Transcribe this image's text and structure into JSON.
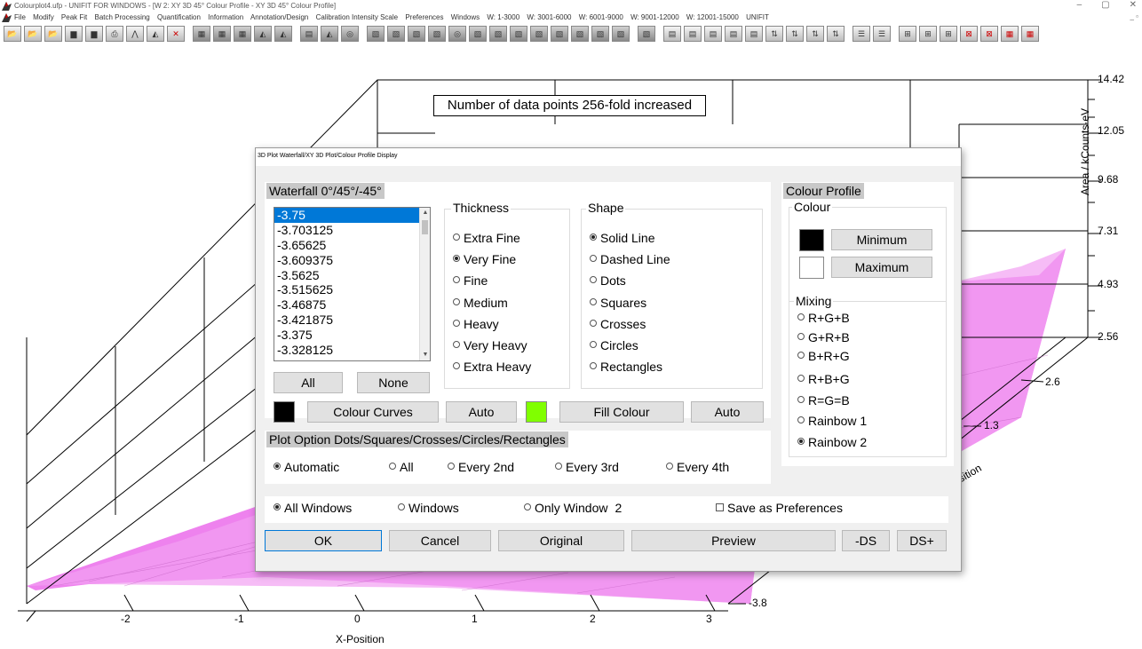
{
  "window": {
    "title": "Colourplot4.ufp - UNIFIT FOR WINDOWS - [W 2: XY 3D 45° Colour Profile - XY 3D 45° Colour Profile]",
    "controls": [
      "–",
      "▢",
      "✕"
    ]
  },
  "menu": {
    "items": [
      "File",
      "Modify",
      "Peak Fit",
      "Batch Processing",
      "Quantification",
      "Information",
      "Annotation/Design",
      "Calibration Intensity Scale",
      "Preferences",
      "Windows",
      "W: 1-3000",
      "W: 3001-6000",
      "W: 6001-9000",
      "W: 9001-12000",
      "W: 12001-15000",
      "UNIFIT"
    ],
    "right": "_ ▫"
  },
  "plot": {
    "annotation": "Number of data points 256-fold increased",
    "x_axis": {
      "label": "X-Position",
      "ticks": [
        "-2",
        "-1",
        "0",
        "1",
        "2",
        "3"
      ]
    },
    "y_axis": {
      "label_partial": "sition",
      "ticks": [
        "2.6",
        "1.3",
        "-3.8"
      ]
    },
    "z_axis": {
      "label_partial": "Area / kCounts·eV",
      "ticks": [
        "14.42",
        "12.05",
        "9.68",
        "7.31",
        "4.93",
        "2.56"
      ]
    },
    "surface_color": "#ee82ee"
  },
  "dialog": {
    "title": "3D Plot Waterfall/XY 3D Plot/Colour Profile Display",
    "waterfall": {
      "header": "Waterfall 0°/45°/-45°",
      "list": [
        "-3.75",
        "-3.703125",
        "-3.65625",
        "-3.609375",
        "-3.5625",
        "-3.515625",
        "-3.46875",
        "-3.421875",
        "-3.375",
        "-3.328125"
      ],
      "selected_index": 0,
      "all_label": "All",
      "none_label": "None"
    },
    "thickness": {
      "title": "Thickness",
      "options": [
        "Extra Fine",
        "Very Fine",
        "Fine",
        "Medium",
        "Heavy",
        "Very Heavy",
        "Extra Heavy"
      ],
      "selected": "Very Fine"
    },
    "shape": {
      "title": "Shape",
      "options": [
        "Solid Line",
        "Dashed Line",
        "Dots",
        "Squares",
        "Crosses",
        "Circles",
        "Rectangles"
      ],
      "selected": "Solid Line"
    },
    "curves_row": {
      "curve_color": "#000000",
      "colour_curves_label": "Colour Curves",
      "auto1_label": "Auto",
      "fill_color": "#80ff00",
      "fill_colour_label": "Fill Colour",
      "auto2_label": "Auto"
    },
    "plot_option": {
      "header": "Plot Option Dots/Squares/Crosses/Circles/Rectangles",
      "options": [
        "Automatic",
        "All",
        "Every 2nd",
        "Every 3rd",
        "Every 4th"
      ],
      "selected": "Automatic"
    },
    "windows_row": {
      "all_windows": "All Windows",
      "windows": "Windows",
      "only_window": "Only Window",
      "only_window_num": "2",
      "save_pref": "Save as Preferences"
    },
    "buttons": {
      "ok": "OK",
      "cancel": "Cancel",
      "original": "Original",
      "preview": "Preview",
      "minus_ds": "-DS",
      "ds_plus": "DS+"
    },
    "colour_profile": {
      "header": "Colour Profile",
      "colour_title": "Colour",
      "minimum_label": "Minimum",
      "minimum_color": "#000000",
      "maximum_label": "Maximum",
      "maximum_color": "#ffffff",
      "mixing_title": "Mixing",
      "mixing_options": [
        "R+G+B",
        "G+R+B",
        "B+R+G",
        "R+B+G",
        "R=G=B",
        "Rainbow 1",
        "Rainbow 2"
      ],
      "mixing_selected": "Rainbow 2"
    }
  }
}
